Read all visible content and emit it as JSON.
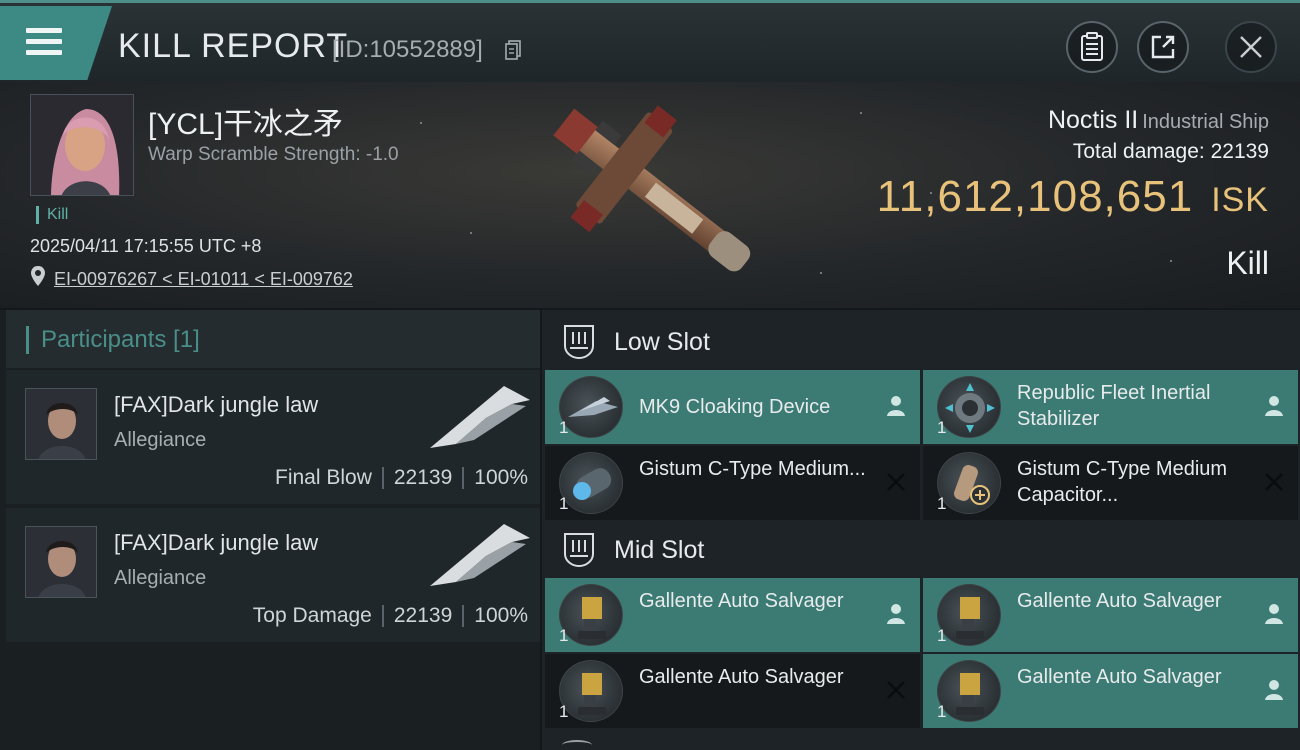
{
  "header": {
    "title": "KILL REPORT",
    "report_id": "[ID:10552889]"
  },
  "victim": {
    "name": "[YCL]干冰之矛",
    "warp_scramble": "Warp Scramble Strength: -1.0",
    "tag": "Kill",
    "timestamp": "2025/04/11 17:15:55 UTC +8",
    "location": "EI-00976267 < EI-01011 < EI-009762",
    "ship_name": "Noctis II",
    "ship_class": "Industrial Ship",
    "total_damage_label": "Total damage:",
    "total_damage": "22139",
    "isk_value": "11,612,108,651",
    "isk_unit": "ISK",
    "result": "Kill"
  },
  "participants": {
    "title": "Participants [1]",
    "items": [
      {
        "name": "[FAX]Dark jungle law",
        "affiliation": "Allegiance",
        "role": "Final Blow",
        "damage": "22139",
        "percent": "100%"
      },
      {
        "name": "[FAX]Dark jungle law",
        "affiliation": "Allegiance",
        "role": "Top Damage",
        "damage": "22139",
        "percent": "100%"
      }
    ]
  },
  "slots": {
    "low": {
      "title": "Low Slot",
      "items": [
        {
          "name": "MK9 Cloaking Device",
          "qty": "1",
          "status": "dropped"
        },
        {
          "name": "Republic Fleet Inertial Stabilizer",
          "qty": "1",
          "status": "dropped"
        },
        {
          "name": "Gistum C-Type Medium...",
          "qty": "1",
          "status": "destroyed"
        },
        {
          "name": "Gistum C-Type Medium Capacitor...",
          "qty": "1",
          "status": "destroyed"
        }
      ]
    },
    "mid": {
      "title": "Mid Slot",
      "items": [
        {
          "name": "Gallente Auto Salvager",
          "qty": "1",
          "status": "dropped"
        },
        {
          "name": "Gallente Auto Salvager",
          "qty": "1",
          "status": "dropped"
        },
        {
          "name": "Gallente Auto Salvager",
          "qty": "1",
          "status": "destroyed"
        },
        {
          "name": "Gallente Auto Salvager",
          "qty": "1",
          "status": "dropped"
        }
      ]
    }
  },
  "colors": {
    "accent_teal": "#3c7a74",
    "isk_gold": "#e8c27a",
    "header_teal": "#4a8e88"
  }
}
